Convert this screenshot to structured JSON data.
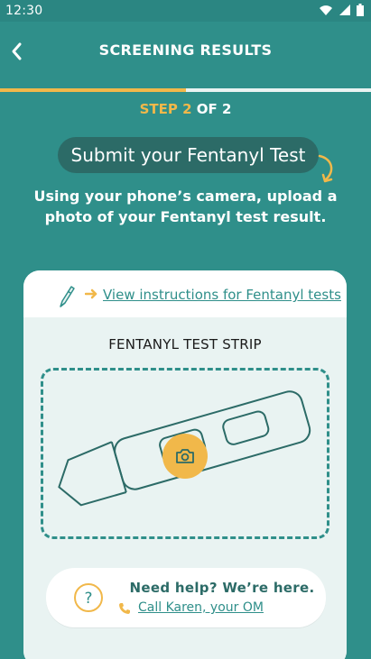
{
  "status": {
    "time": "12:30"
  },
  "header": {
    "title": "SCREENING RESULTS"
  },
  "progress": {
    "current": 2,
    "total": 2,
    "fill_percent": 50,
    "step_prefix": "STEP 2",
    "step_suffix": " OF 2"
  },
  "colors": {
    "teal": "#2f8f8a",
    "dark_teal": "#2c6b67",
    "accent": "#f1b84a",
    "light_bg": "#e9f3f2"
  },
  "pill": {
    "text": "Submit your Fentanyl Test"
  },
  "instructions": {
    "text": "Using your phone’s camera, upload a photo of your Fentanyl test result."
  },
  "card": {
    "link_text": "View instructions for Fentanyl tests",
    "strip_label": "FENTANYL TEST STRIP"
  },
  "help": {
    "title": "Need help? We’re here.",
    "call_label": "Call Karen, your OM"
  },
  "icons": {
    "back": "chevron-left-icon",
    "wifi": "wifi-icon",
    "signal": "cell-signal-icon",
    "battery": "battery-icon",
    "pencil": "pencil-icon",
    "arrow": "arrow-right-icon",
    "camera": "camera-icon",
    "help": "question-circle-icon",
    "phone": "phone-icon"
  }
}
